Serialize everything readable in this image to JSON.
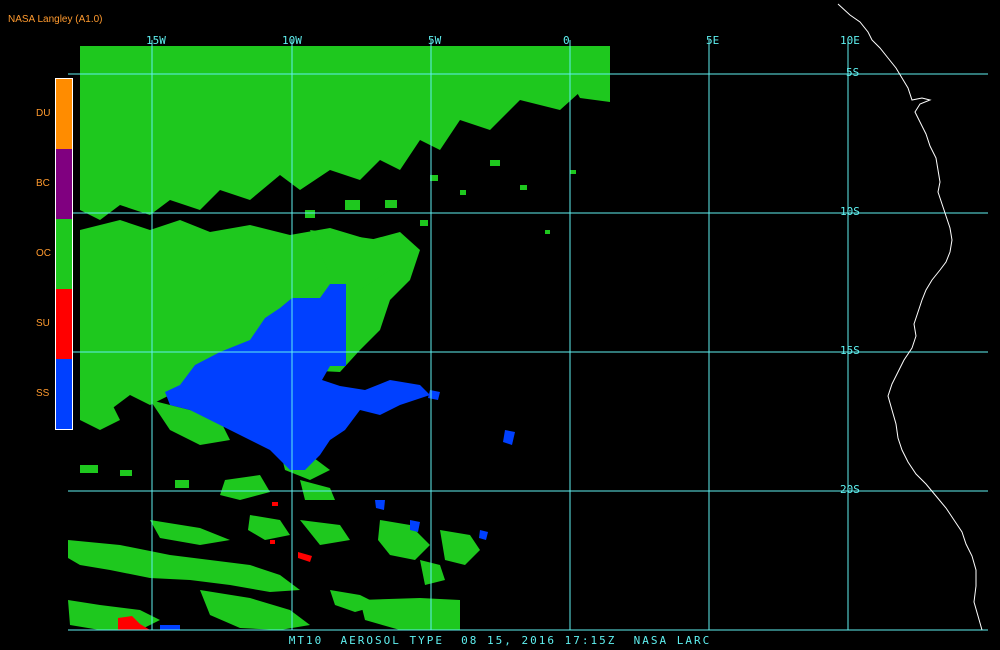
{
  "credit": "NASA Langley (A1.0)",
  "caption": "MT10  AEROSOL TYPE  08 15, 2016 17:15Z  NASA LARC",
  "colors": {
    "grid": "#5ff0f0",
    "coast": "#ffffff",
    "label": "#ff9a2e",
    "ocean": "#000000"
  },
  "legend": [
    {
      "code": "DU",
      "color": "#ff8c00"
    },
    {
      "code": "BC",
      "color": "#800080"
    },
    {
      "code": "OC",
      "color": "#1ec81e"
    },
    {
      "code": "SU",
      "color": "#ff0000"
    },
    {
      "code": "SS",
      "color": "#0040ff"
    }
  ],
  "longitudes": [
    "15W",
    "10W",
    "5W",
    "0",
    "5E",
    "10E"
  ],
  "latitudes": [
    "5S",
    "10S",
    "15S",
    "20S"
  ]
}
